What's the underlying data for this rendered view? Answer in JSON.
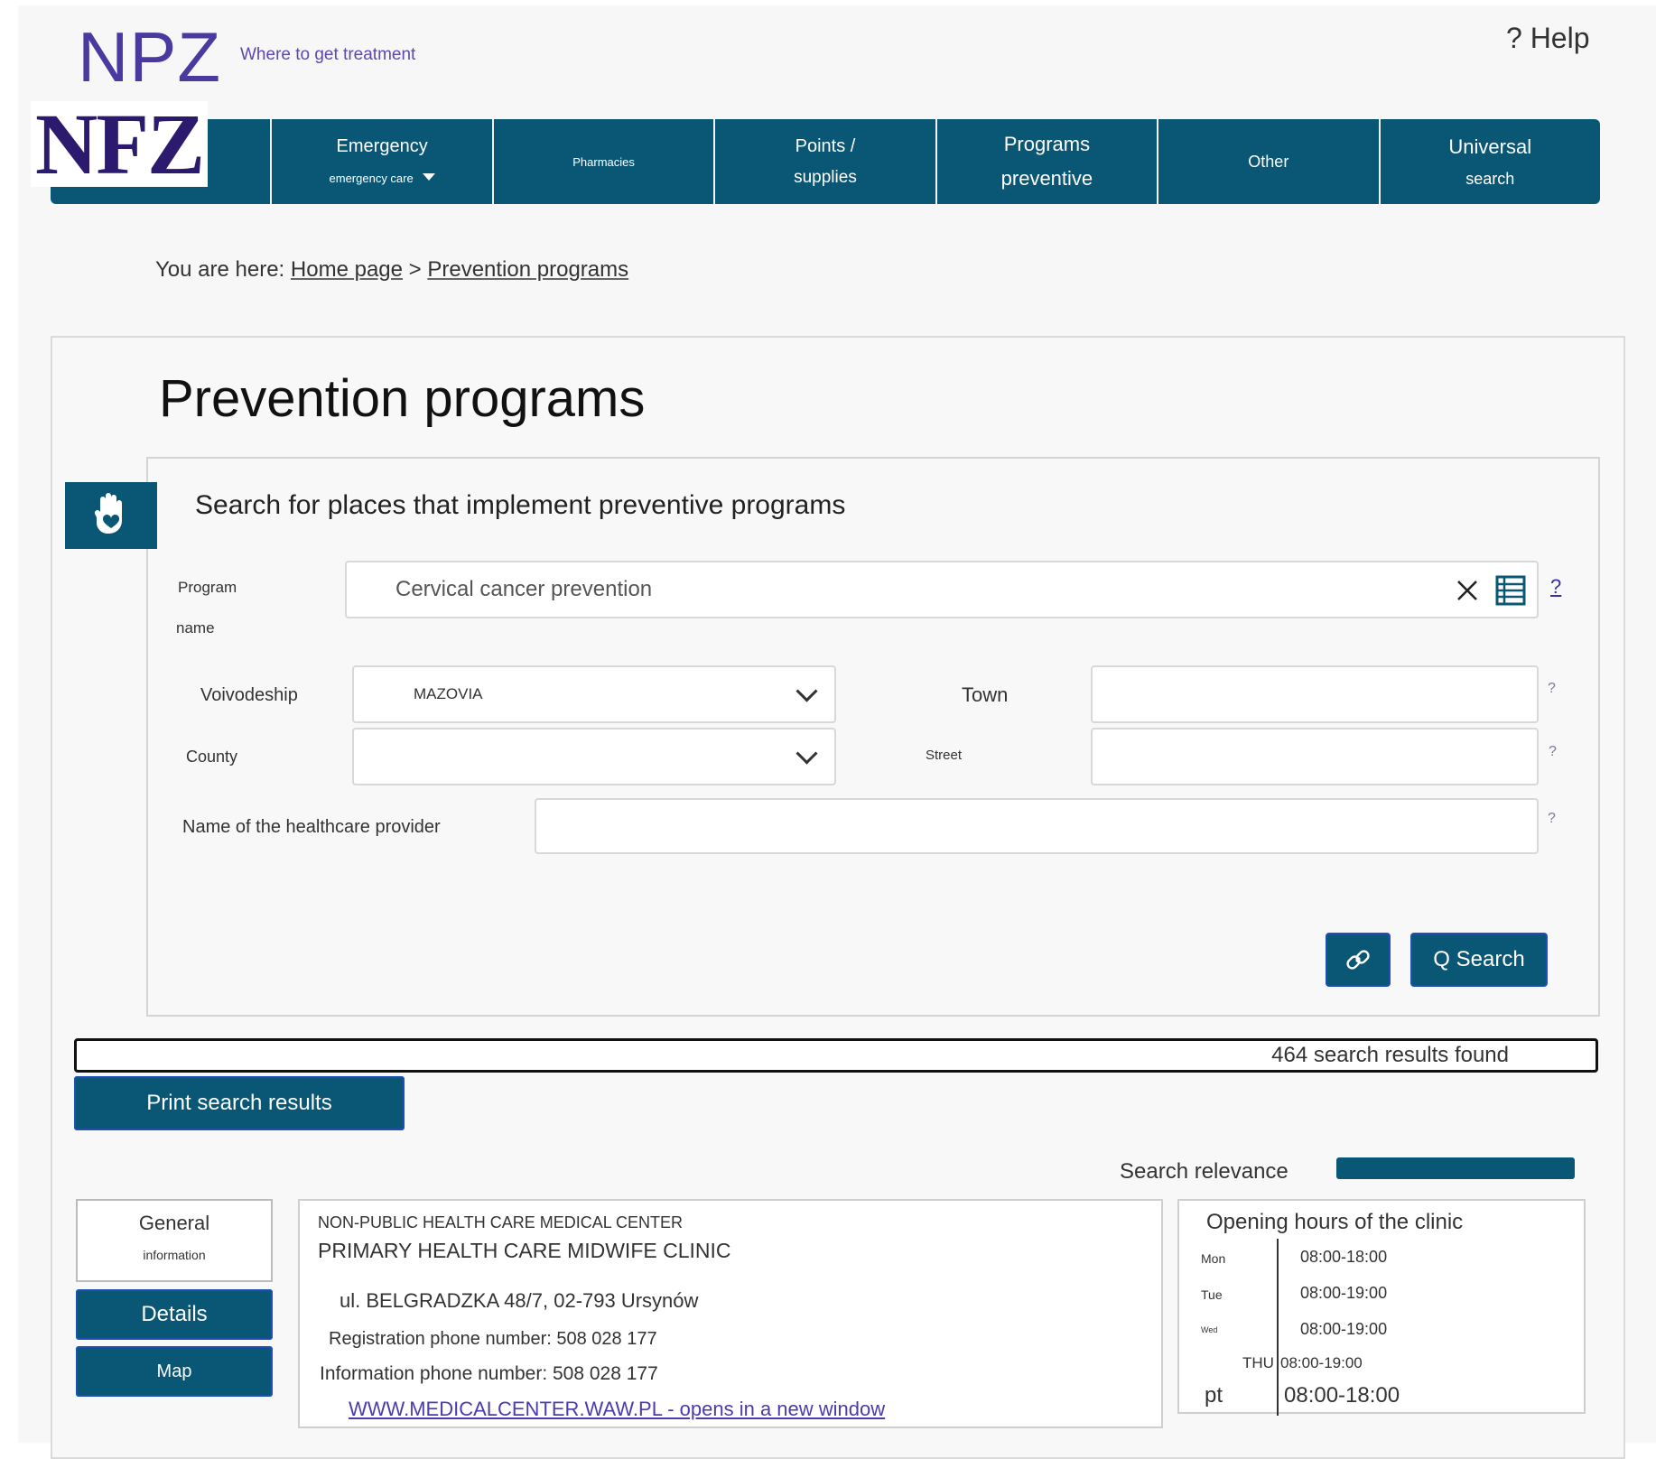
{
  "header": {
    "brand": "NPZ",
    "tagline": "Where to get treatment",
    "logo": "NFZ",
    "help": "? Help"
  },
  "nav": [
    {
      "l1": "Emergency",
      "l2": "emergency care"
    },
    {
      "l1": "Pharmacies",
      "l2": ""
    },
    {
      "l1": "Points /",
      "l2": "supplies"
    },
    {
      "l1": "Programs",
      "l2": "preventive"
    },
    {
      "l1": "Other",
      "l2": ""
    },
    {
      "l1": "Universal",
      "l2": "search"
    }
  ],
  "breadcrumb": {
    "prefix": "You are here:",
    "home": "Home page",
    "separator": ">",
    "current": "Prevention programs"
  },
  "page": {
    "title": "Prevention programs",
    "search_heading": "Search for places that implement preventive programs"
  },
  "form": {
    "program_label_1": "Program",
    "program_label_2": "name",
    "program_value": "Cervical cancer prevention",
    "voivodeship_label": "Voivodeship",
    "voivodeship_value": "MAZOVIA",
    "county_label": "County",
    "county_value": "",
    "town_label": "Town",
    "town_value": "",
    "street_label": "Street",
    "street_value": "",
    "provider_label": "Name of the healthcare provider",
    "provider_value": "",
    "help_mark": "?",
    "search_button": "Q Search"
  },
  "results": {
    "count_text": "464 search results found",
    "print_button": "Print search results",
    "relevance_label": "Search relevance"
  },
  "tabs": {
    "general_1": "General",
    "general_2": "information",
    "details": "Details",
    "map": "Map"
  },
  "clinic": {
    "type": "NON-PUBLIC HEALTH CARE MEDICAL CENTER",
    "name": "PRIMARY HEALTH CARE MIDWIFE CLINIC",
    "address": "ul. BELGRADZKA 48/7, 02-793 Ursynów",
    "registration_phone": "Registration phone number: 508 028 177",
    "info_phone": "Information phone number: 508 028 177",
    "website": "WWW.MEDICALCENTER.WAW.PL - opens in a new window"
  },
  "hours": {
    "title": "Opening hours of the clinic",
    "rows": [
      {
        "day": "Mon",
        "time": "08:00-18:00"
      },
      {
        "day": "Tue",
        "time": "08:00-19:00"
      },
      {
        "day": "Wed",
        "time": "08:00-19:00"
      },
      {
        "day": "THU",
        "time": "08:00-19:00"
      },
      {
        "day": "pt",
        "time": "08:00-18:00"
      }
    ]
  },
  "colors": {
    "primary": "#0a5775",
    "brand": "#4a3aa0",
    "button_border": "#1e4fb8"
  },
  "icons": [
    "hand-icon",
    "close-icon",
    "list-icon",
    "chevron-down-icon",
    "link-icon",
    "caret-down-icon"
  ]
}
